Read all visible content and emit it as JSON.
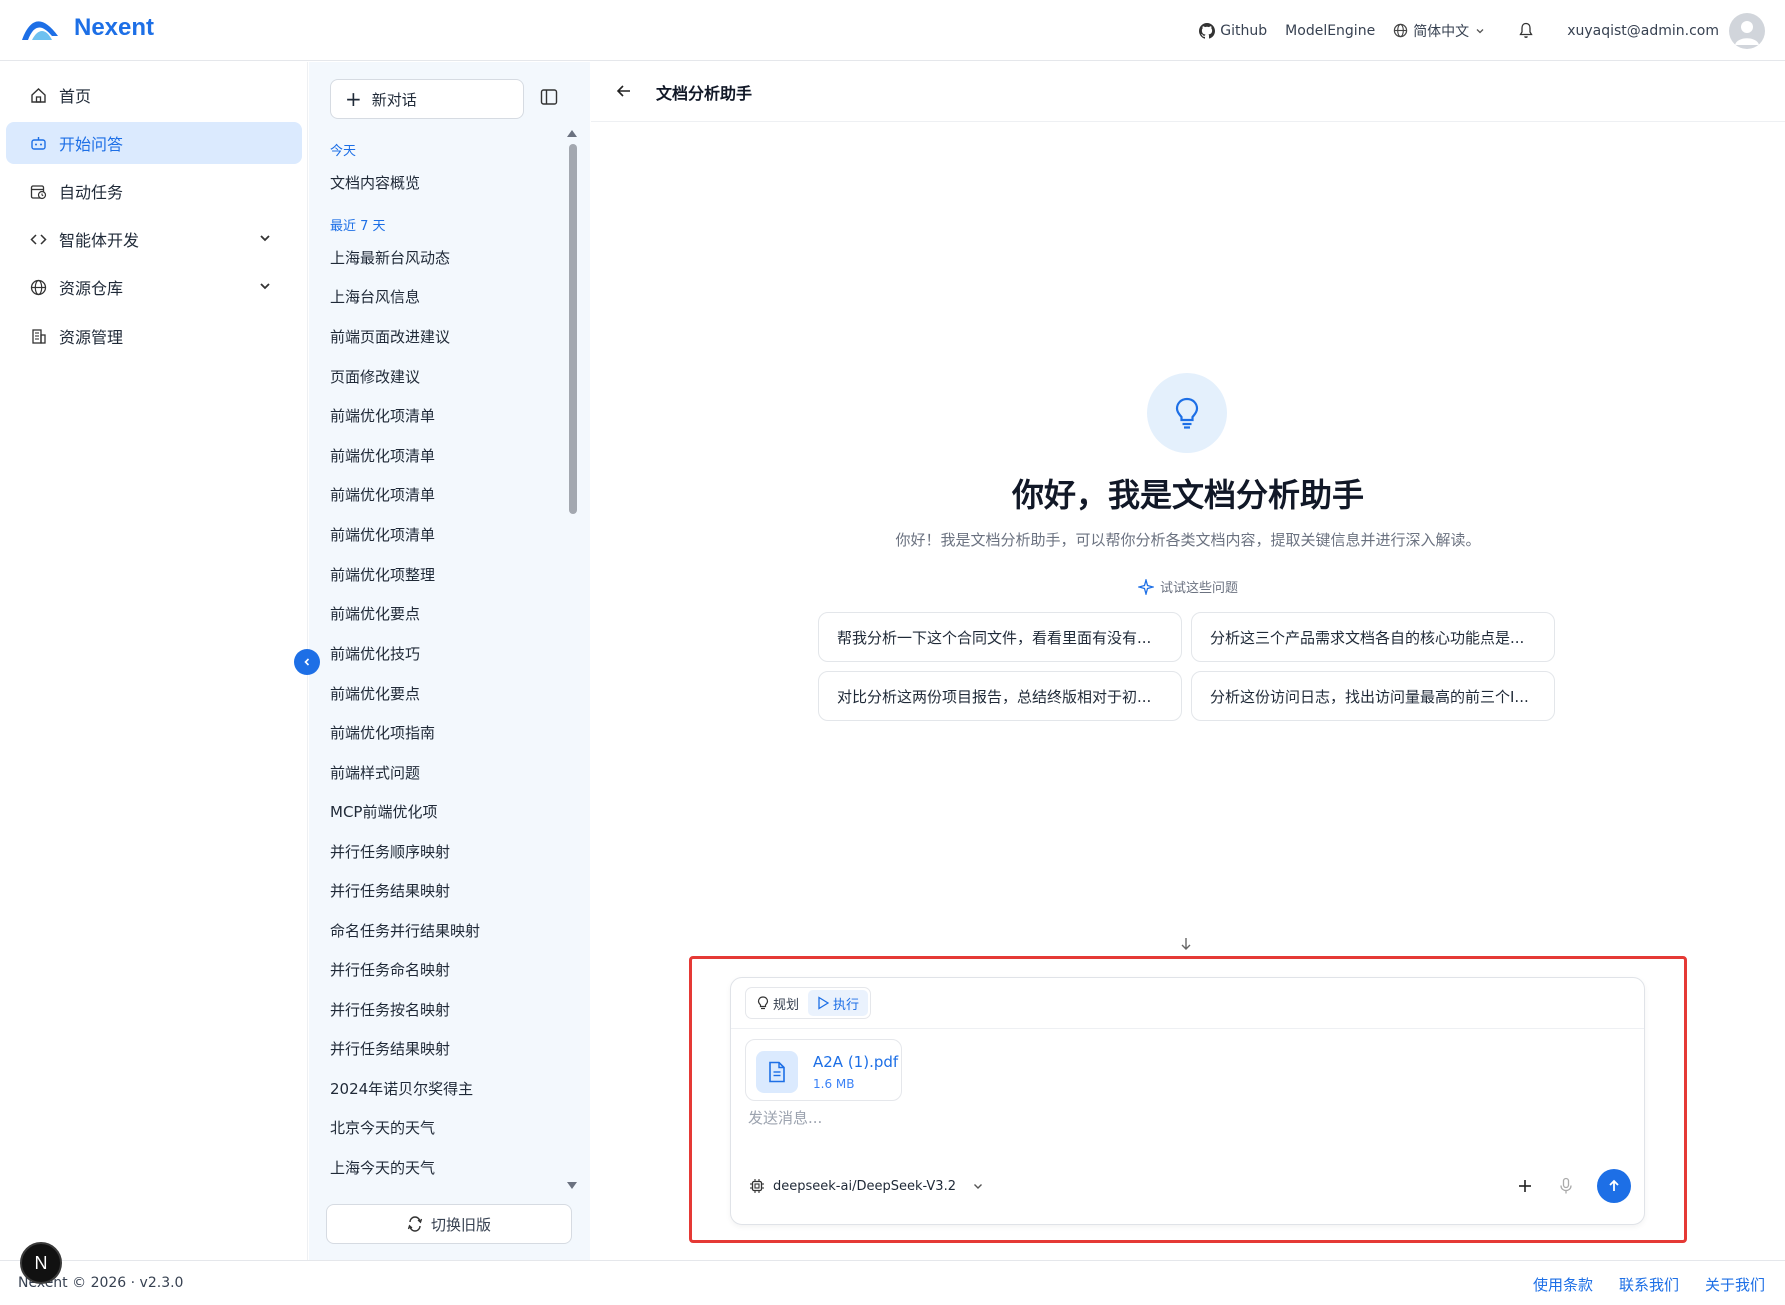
{
  "app": {
    "name": "Nexent"
  },
  "topbar": {
    "github_label": "Github",
    "modelengine_label": "ModelEngine",
    "language_label": "简体中文",
    "user_email": "xuyaqist@admin.com"
  },
  "nav": {
    "items": [
      {
        "label": "首页",
        "icon": "home-icon",
        "active": false
      },
      {
        "label": "开始问答",
        "icon": "robot-icon",
        "active": true
      },
      {
        "label": "自动任务",
        "icon": "calendar-clock-icon",
        "active": false
      },
      {
        "label": "智能体开发",
        "icon": "code-icon",
        "active": false,
        "expandable": true
      },
      {
        "label": "资源仓库",
        "icon": "globe-icon",
        "active": false,
        "expandable": true
      },
      {
        "label": "资源管理",
        "icon": "building-icon",
        "active": false
      }
    ]
  },
  "conversations": {
    "new_chat_label": "新对话",
    "groups": [
      {
        "label": "今天",
        "items": [
          "文档内容概览"
        ]
      },
      {
        "label": "最近 7 天",
        "items": [
          "上海最新台风动态",
          "上海台风信息",
          "前端页面改进建议",
          "页面修改建议",
          "前端优化项清单",
          "前端优化项清单",
          "前端优化项清单",
          "前端优化项清单",
          "前端优化项整理",
          "前端优化要点",
          "前端优化技巧",
          "前端优化要点",
          "前端优化项指南",
          "前端样式问题",
          "MCP前端优化项",
          "并行任务顺序映射",
          "并行任务结果映射",
          "命名任务并行结果映射",
          "并行任务命名映射",
          "并行任务按名映射",
          "并行任务结果映射",
          "2024年诺贝尔奖得主",
          "北京今天的天气",
          "上海今天的天气"
        ]
      }
    ],
    "switch_old_label": "切换旧版"
  },
  "main": {
    "title": "文档分析助手",
    "greeting": "你好，我是文档分析助手",
    "subtitle": "你好！我是文档分析助手，可以帮你分析各类文档内容，提取关键信息并进行深入解读。",
    "try_label": "试试这些问题",
    "suggestions": [
      "帮我分析一下这个合同文件，看看里面有没有...",
      "分析这三个产品需求文档各自的核心功能点是...",
      "对比分析这两份项目报告，总结终版相对于初...",
      "分析这份访问日志，找出访问量最高的前三个I..."
    ]
  },
  "composer": {
    "mode_plan": "规划",
    "mode_execute": "执行",
    "active_mode": "执行",
    "file": {
      "name": "A2A (1).pdf",
      "size": "1.6 MB"
    },
    "placeholder": "发送消息...",
    "model": "deepseek-ai/DeepSeek-V3.2"
  },
  "footer": {
    "copyright": "Nexent © 2026 · v2.3.0",
    "links": [
      "使用条款",
      "联系我们",
      "关于我们"
    ]
  },
  "badge": {
    "letter": "N"
  },
  "colors": {
    "accent": "#1d6fe6",
    "active_bg": "#dbeafe",
    "panel_bg": "#f3f8fd",
    "highlight": "#e53935"
  }
}
